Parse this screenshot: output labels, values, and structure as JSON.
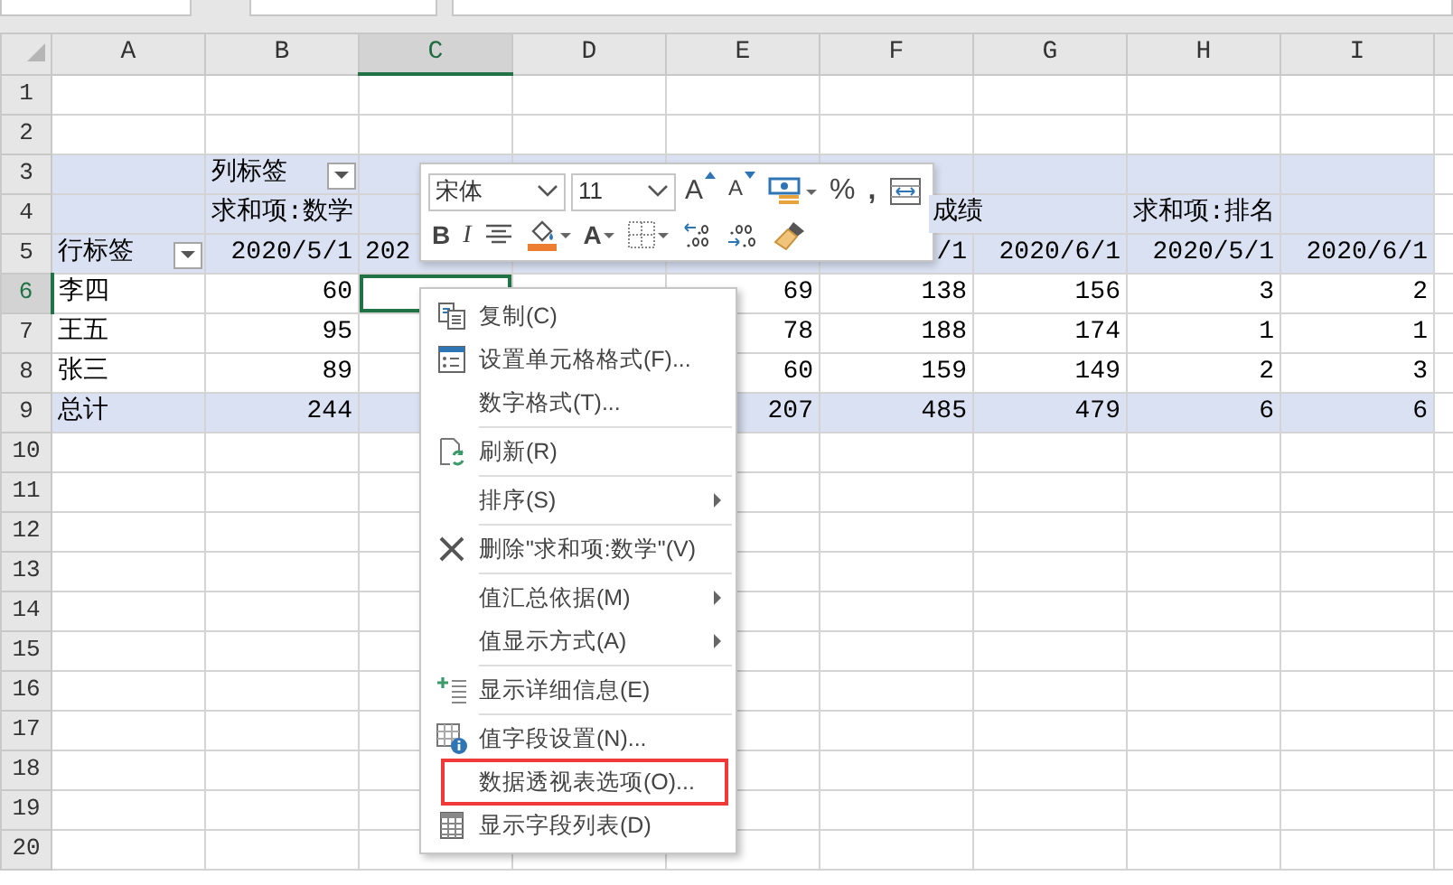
{
  "columns": [
    {
      "label": "A",
      "selected": false
    },
    {
      "label": "B",
      "selected": false
    },
    {
      "label": "C",
      "selected": true
    },
    {
      "label": "D",
      "selected": false
    },
    {
      "label": "E",
      "selected": false
    },
    {
      "label": "F",
      "selected": false
    },
    {
      "label": "G",
      "selected": false
    },
    {
      "label": "H",
      "selected": false
    },
    {
      "label": "I",
      "selected": false
    }
  ],
  "rows": [
    {
      "number": "1",
      "selected": false,
      "kind": "plain"
    },
    {
      "number": "2",
      "selected": false,
      "kind": "plain"
    },
    {
      "number": "3",
      "selected": false,
      "kind": "pivot-header",
      "cells": [
        null,
        {
          "text": "列标签",
          "filter_button": true
        },
        null,
        null,
        null,
        null,
        null,
        null,
        null
      ]
    },
    {
      "number": "4",
      "selected": false,
      "kind": "pivot-header",
      "cells": [
        null,
        {
          "text": "求和项:数学"
        },
        null,
        null,
        null,
        {
          "text": "成绩",
          "kind": "spill-tail"
        },
        null,
        {
          "text": "求和项:排名"
        },
        null
      ]
    },
    {
      "number": "5",
      "selected": false,
      "kind": "pivot-labels",
      "cells": [
        {
          "text": "行标签",
          "filter_button": true
        },
        {
          "text": "2020/5/1"
        },
        {
          "text": "202",
          "kind": "head"
        },
        null,
        null,
        {
          "text": "/1",
          "kind": "tail"
        },
        {
          "text": "2020/6/1"
        },
        {
          "text": "2020/5/1"
        },
        {
          "text": "2020/6/1"
        }
      ]
    },
    {
      "number": "6",
      "selected": true,
      "kind": "data",
      "cells": [
        {
          "text": "李四"
        },
        {
          "text": "60"
        },
        null,
        null,
        {
          "text": "69"
        },
        {
          "text": "138"
        },
        {
          "text": "156"
        },
        {
          "text": "3"
        },
        {
          "text": "2"
        }
      ]
    },
    {
      "number": "7",
      "selected": false,
      "kind": "data",
      "cells": [
        {
          "text": "王五"
        },
        {
          "text": "95"
        },
        null,
        null,
        {
          "text": "78"
        },
        {
          "text": "188"
        },
        {
          "text": "174"
        },
        {
          "text": "1"
        },
        {
          "text": "1"
        }
      ]
    },
    {
      "number": "8",
      "selected": false,
      "kind": "data",
      "cells": [
        {
          "text": "张三"
        },
        {
          "text": "89"
        },
        null,
        null,
        {
          "text": "60"
        },
        {
          "text": "159"
        },
        {
          "text": "149"
        },
        {
          "text": "2"
        },
        {
          "text": "3"
        }
      ]
    },
    {
      "number": "9",
      "selected": false,
      "kind": "total",
      "cells": [
        {
          "text": "总计"
        },
        {
          "text": "244"
        },
        null,
        null,
        {
          "text": "207"
        },
        {
          "text": "485"
        },
        {
          "text": "479"
        },
        {
          "text": "6"
        },
        {
          "text": "6"
        }
      ]
    },
    {
      "number": "10",
      "selected": false,
      "kind": "plain"
    },
    {
      "number": "11",
      "selected": false,
      "kind": "plain"
    },
    {
      "number": "12",
      "selected": false,
      "kind": "plain"
    },
    {
      "number": "13",
      "selected": false,
      "kind": "plain"
    },
    {
      "number": "14",
      "selected": false,
      "kind": "plain"
    },
    {
      "number": "15",
      "selected": false,
      "kind": "plain"
    },
    {
      "number": "16",
      "selected": false,
      "kind": "plain"
    },
    {
      "number": "17",
      "selected": false,
      "kind": "plain"
    },
    {
      "number": "18",
      "selected": false,
      "kind": "plain"
    },
    {
      "number": "19",
      "selected": false,
      "kind": "plain"
    },
    {
      "number": "20",
      "selected": false,
      "kind": "plain"
    }
  ],
  "mini_toolbar": {
    "top_row": [
      {
        "kind": "select",
        "value": "宋体"
      },
      {
        "kind": "select-narrow",
        "value": "11"
      },
      {
        "kind": "grow-font",
        "label": "A"
      },
      {
        "kind": "shrink-font",
        "label": "A"
      },
      {
        "kind": "accounting"
      },
      {
        "kind": "percent",
        "label": "%"
      },
      {
        "kind": "comma",
        "label": ","
      },
      {
        "kind": "wrap"
      }
    ],
    "bottom_row": [
      {
        "kind": "bold",
        "label": "B"
      },
      {
        "kind": "italic",
        "label": "I"
      },
      {
        "kind": "center"
      },
      {
        "kind": "fill-color"
      },
      {
        "kind": "font-color",
        "label": "A"
      },
      {
        "kind": "borders"
      },
      {
        "kind": "decrease-decimal"
      },
      {
        "kind": "increase-decimal"
      },
      {
        "kind": "format-painter"
      }
    ]
  },
  "context_menu": {
    "items": [
      {
        "kind": "copy",
        "label": "复制(C)"
      },
      {
        "kind": "format",
        "label": "设置单元格格式(F)..."
      },
      {
        "kind": "plain",
        "label": "数字格式(T)..."
      },
      {
        "kind": "separator"
      },
      {
        "kind": "refresh",
        "label": "刷新(R)"
      },
      {
        "kind": "separator"
      },
      {
        "kind": "plain",
        "label": "排序(S)",
        "submenu": true
      },
      {
        "kind": "separator"
      },
      {
        "kind": "delete",
        "label": "删除\"求和项:数学\"(V)"
      },
      {
        "kind": "separator"
      },
      {
        "kind": "plain",
        "label": "值汇总依据(M)",
        "submenu": true
      },
      {
        "kind": "plain",
        "label": "值显示方式(A)",
        "submenu": true
      },
      {
        "kind": "separator"
      },
      {
        "kind": "detail",
        "label": "显示详细信息(E)"
      },
      {
        "kind": "separator"
      },
      {
        "kind": "settings",
        "label": "值字段设置(N)..."
      },
      {
        "kind": "plain",
        "label": "数据透视表选项(O)...",
        "highlighted": true
      },
      {
        "kind": "fieldlist",
        "label": "显示字段列表(D)"
      }
    ]
  }
}
